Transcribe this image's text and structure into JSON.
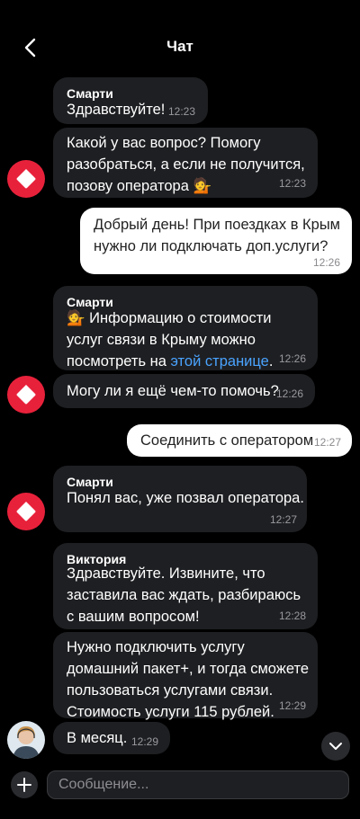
{
  "header": {
    "title": "Чат",
    "back_icon": "chevron-left-icon"
  },
  "messages": [
    {
      "sender": "Смарти",
      "text": "Здравствуйте!",
      "time": "12:23"
    },
    {
      "text": "Какой у вас вопрос? Помогу\nразобраться, а если не получится,\nпозову оператора 💁",
      "time": "12:23"
    },
    {
      "text": "Добрый день! При поездках в Крым\nнужно ли подключать доп.услуги?",
      "time": "12:26"
    },
    {
      "sender": "Смарти",
      "text_before": "💁 Информацию о стоимости\nуслуг связи в Крыму можно\nпосмотреть на ",
      "link": "этой странице",
      "text_after": ".",
      "time": "12:26"
    },
    {
      "text": "Могу ли я ещё чем-то помочь?",
      "time": "12:26"
    },
    {
      "text": "Соединить с оператором",
      "time": "12:27"
    },
    {
      "sender": "Смарти",
      "text": "Понял вас, уже позвал оператора.",
      "time": "12:27"
    },
    {
      "sender": "Виктория",
      "text": "Здравствуйте. Извините, что\nзаставила вас ждать, разбираюсь\nс вашим вопросом!",
      "time": "12:28"
    },
    {
      "text": "Нужно подключить услугу\nдомашний пакет+, и тогда сможете\nпользоваться услугами связи.\nСтоимость услуги 115 рублей.",
      "time": "12:29"
    },
    {
      "text": "В месяц.",
      "time": "12:29"
    }
  ],
  "composer": {
    "placeholder": "Сообщение...",
    "plus_icon": "plus-icon"
  },
  "colors": {
    "background": "#000000",
    "incoming": "#1e1f22",
    "outgoing": "#ffffff",
    "bot_avatar": "#e8213b",
    "link": "#4aa3ff"
  }
}
